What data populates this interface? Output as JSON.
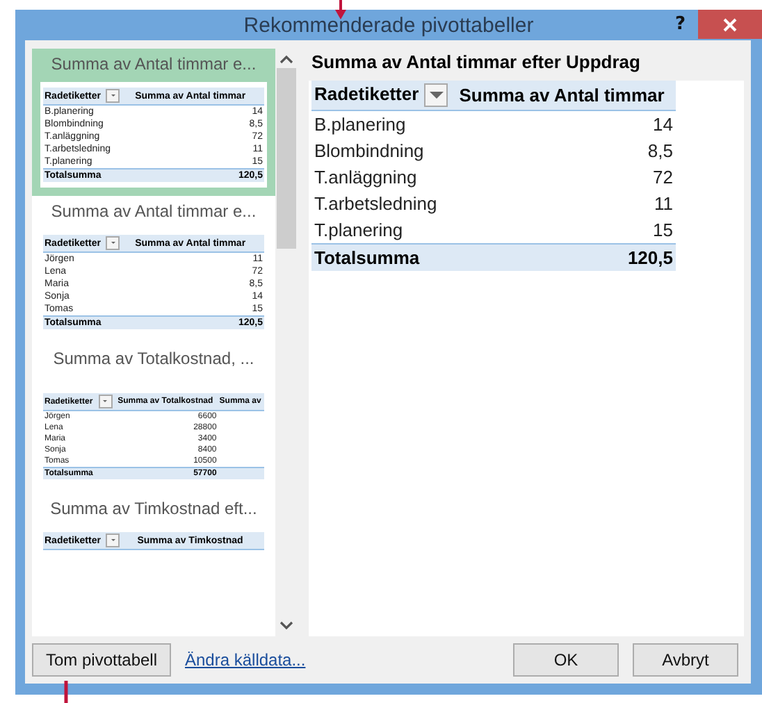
{
  "window": {
    "title": "Rekommenderade pivottabeller",
    "help": "?"
  },
  "recommendations": [
    {
      "title": "Summa av Antal timmar e...",
      "selected": true,
      "table": {
        "columns": [
          "Radetiketter",
          "Summa av Antal timmar"
        ],
        "rows": [
          {
            "label": "B.planering",
            "values": [
              "14"
            ]
          },
          {
            "label": "Blombindning",
            "values": [
              "8,5"
            ]
          },
          {
            "label": "T.anläggning",
            "values": [
              "72"
            ]
          },
          {
            "label": "T.arbetsledning",
            "values": [
              "11"
            ]
          },
          {
            "label": "T.planering",
            "values": [
              "15"
            ]
          }
        ],
        "total": {
          "label": "Totalsumma",
          "values": [
            "120,5"
          ]
        }
      }
    },
    {
      "title": "Summa av Antal timmar e...",
      "selected": false,
      "table": {
        "columns": [
          "Radetiketter",
          "Summa av Antal timmar"
        ],
        "rows": [
          {
            "label": "Jörgen",
            "values": [
              "11"
            ]
          },
          {
            "label": "Lena",
            "values": [
              "72"
            ]
          },
          {
            "label": "Maria",
            "values": [
              "8,5"
            ]
          },
          {
            "label": "Sonja",
            "values": [
              "14"
            ]
          },
          {
            "label": "Tomas",
            "values": [
              "15"
            ]
          }
        ],
        "total": {
          "label": "Totalsumma",
          "values": [
            "120,5"
          ]
        }
      }
    },
    {
      "title": "Summa av Totalkostnad, ...",
      "selected": false,
      "table": {
        "columns": [
          "Radetiketter",
          "Summa av Totalkostnad",
          "Summa av"
        ],
        "rows": [
          {
            "label": "Jörgen",
            "values": [
              "6600"
            ]
          },
          {
            "label": "Lena",
            "values": [
              "28800"
            ]
          },
          {
            "label": "Maria",
            "values": [
              "3400"
            ]
          },
          {
            "label": "Sonja",
            "values": [
              "8400"
            ]
          },
          {
            "label": "Tomas",
            "values": [
              "10500"
            ]
          }
        ],
        "total": {
          "label": "Totalsumma",
          "values": [
            "57700"
          ]
        }
      }
    },
    {
      "title": "Summa av Timkostnad eft...",
      "selected": false,
      "table": {
        "columns": [
          "Radetiketter",
          "Summa av Timkostnad"
        ]
      }
    }
  ],
  "preview": {
    "title": "Summa av Antal timmar efter Uppdrag",
    "table": {
      "columns": [
        "Radetiketter",
        "Summa av Antal timmar"
      ],
      "rows": [
        {
          "label": "B.planering",
          "values": [
            "14"
          ]
        },
        {
          "label": "Blombindning",
          "values": [
            "8,5"
          ]
        },
        {
          "label": "T.anläggning",
          "values": [
            "72"
          ]
        },
        {
          "label": "T.arbetsledning",
          "values": [
            "11"
          ]
        },
        {
          "label": "T.planering",
          "values": [
            "15"
          ]
        }
      ],
      "total": {
        "label": "Totalsumma",
        "values": [
          "120,5"
        ]
      }
    }
  },
  "buttons": {
    "blank": "Tom pivottabell",
    "change_source": "Ändra källdata...",
    "ok": "OK",
    "cancel": "Avbryt"
  }
}
